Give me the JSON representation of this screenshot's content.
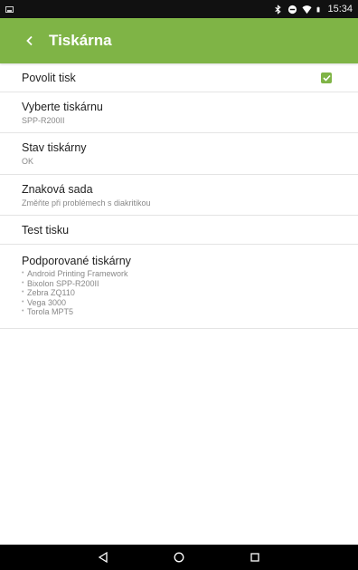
{
  "status_bar": {
    "time": "15:34",
    "icons": [
      "notification-icon",
      "bluetooth-icon",
      "signal-icon",
      "wifi-icon",
      "battery-icon"
    ]
  },
  "app_bar": {
    "title": "Tiskárna",
    "back_icon": "back-icon",
    "color": "#7fb446"
  },
  "settings": {
    "enable_print": {
      "title": "Povolit tisk",
      "checked": true
    },
    "select_printer": {
      "title": "Vyberte tiskárnu",
      "value": "SPP-R200II"
    },
    "printer_status": {
      "title": "Stav tiskárny",
      "value": "OK"
    },
    "charset": {
      "title": "Znaková sada",
      "hint": "Změňte při problémech s diakritikou"
    },
    "test_print": {
      "title": "Test tisku"
    },
    "supported_printers": {
      "title": "Podporované tiskárny",
      "items": [
        "Android Printing Framework",
        "Bixolon SPP-R200II",
        "Zebra ZQ110",
        "Vega 3000",
        "Torola MPT5"
      ]
    }
  },
  "nav_bar": {
    "buttons": [
      "back-triangle-icon",
      "home-circle-icon",
      "recents-square-icon"
    ]
  }
}
